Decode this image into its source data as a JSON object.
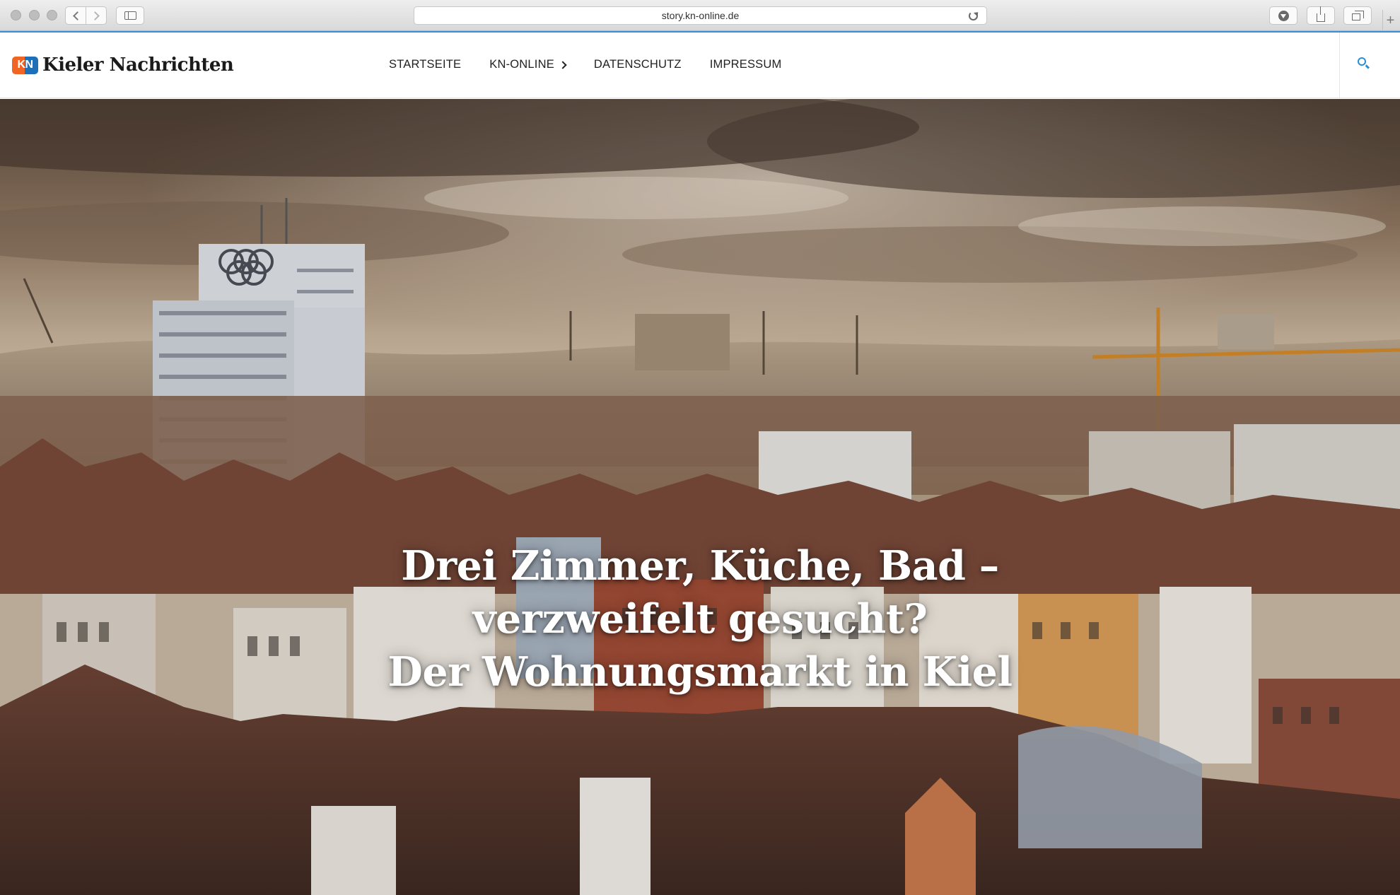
{
  "browser": {
    "url": "story.kn-online.de",
    "new_tab_label": "+"
  },
  "site": {
    "logo_badge": "KN",
    "logo_name": "Kieler Nachrichten",
    "nav": [
      {
        "label": "STARTSEITE"
      },
      {
        "label": "KN-ONLINE",
        "has_submenu": true
      },
      {
        "label": "DATENSCHUTZ"
      },
      {
        "label": "IMPRESSUM"
      }
    ],
    "accent_color": "#2a8ed6"
  },
  "hero": {
    "image_subject": "Kiel city skyline with Olympic rings tower and construction crane",
    "title_lines": [
      "Drei Zimmer, Küche, Bad –",
      "verzweifelt gesucht?",
      "Der Wohnungsmarkt in Kiel"
    ]
  }
}
